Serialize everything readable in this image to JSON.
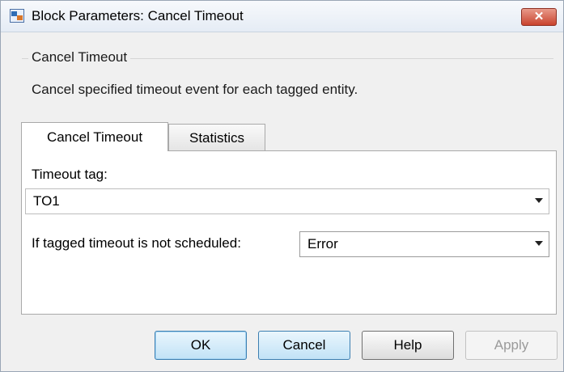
{
  "window": {
    "title": "Block Parameters: Cancel Timeout",
    "close_label": "✕"
  },
  "group": {
    "label": "Cancel Timeout",
    "description": "Cancel specified timeout event for each tagged entity."
  },
  "tabs": [
    {
      "label": "Cancel Timeout",
      "active": true
    },
    {
      "label": "Statistics",
      "active": false
    }
  ],
  "params": {
    "timeout_tag_label": "Timeout tag:",
    "timeout_tag_value": "TO1",
    "not_scheduled_label": "If tagged timeout is not scheduled:",
    "not_scheduled_value": "Error"
  },
  "buttons": {
    "ok": "OK",
    "cancel": "Cancel",
    "help": "Help",
    "apply": "Apply"
  },
  "colors": {
    "close_button": "#c9442f",
    "default_button": "#c1e2f6"
  }
}
